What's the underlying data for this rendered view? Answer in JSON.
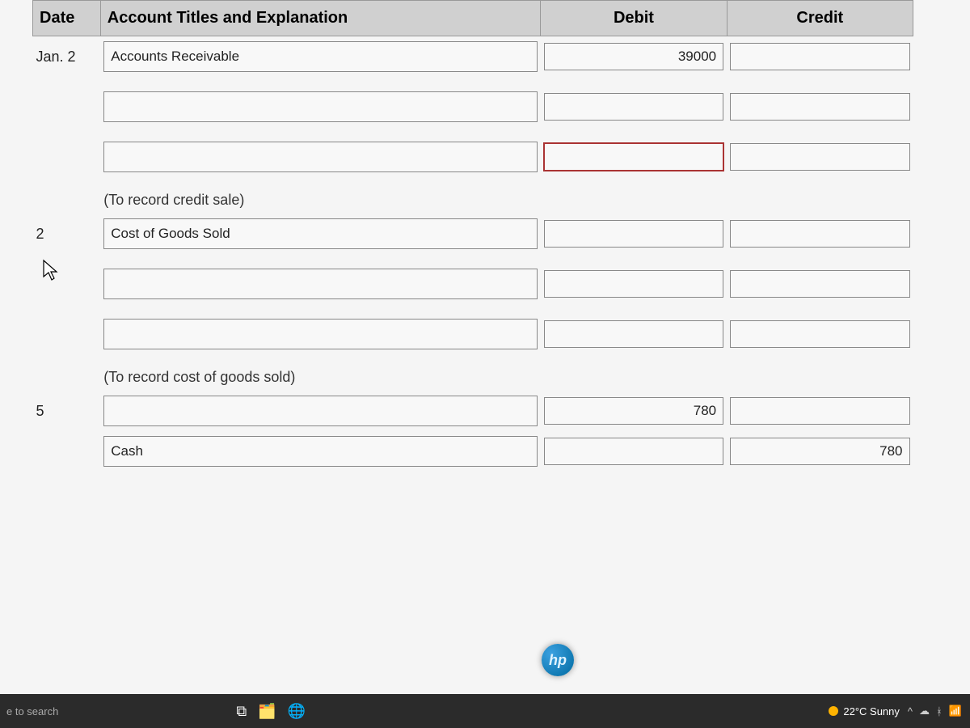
{
  "headers": {
    "date": "Date",
    "account": "Account Titles and Explanation",
    "debit": "Debit",
    "credit": "Credit"
  },
  "rows": [
    {
      "date": "Jan. 2",
      "account": "Accounts Receivable",
      "debit": "39000",
      "credit": ""
    },
    {
      "date": "",
      "account": "",
      "debit": "",
      "credit": ""
    },
    {
      "date": "",
      "account": "",
      "debit": "",
      "credit": "",
      "focused": true
    },
    {
      "explain": "(To record credit sale)"
    },
    {
      "date": "2",
      "account": "Cost of Goods Sold",
      "debit": "",
      "credit": ""
    },
    {
      "date": "",
      "account": "",
      "debit": "",
      "credit": ""
    },
    {
      "date": "",
      "account": "",
      "debit": "",
      "credit": ""
    },
    {
      "explain": "(To record cost of goods sold)"
    },
    {
      "date": "5",
      "account": "",
      "debit": "780",
      "credit": ""
    },
    {
      "date": "",
      "account": "Cash",
      "debit": "",
      "credit": "780"
    }
  ],
  "taskbar": {
    "search_hint": "e to search",
    "weather": "22°C Sunny",
    "tray_caret": "^"
  },
  "badge": "hp"
}
